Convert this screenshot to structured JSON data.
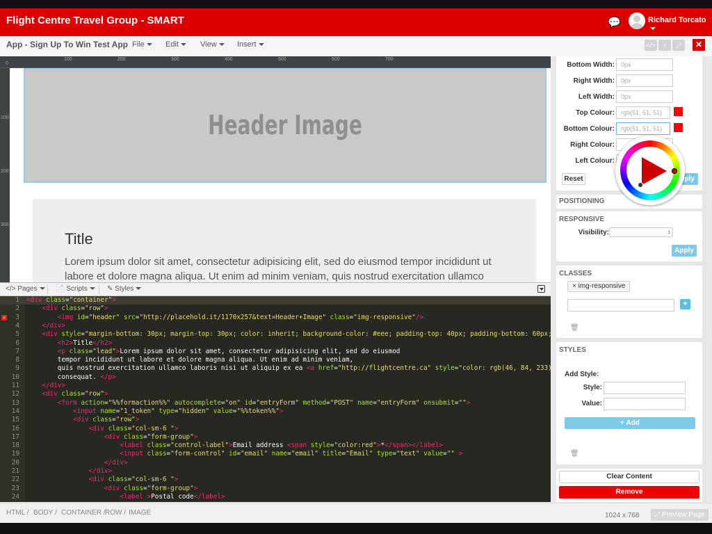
{
  "header": {
    "brand": "Flight Centre Travel Group - SMART",
    "user": "Richard Torcato",
    "brand_color": "#dd0000"
  },
  "menubar": {
    "app_title": "App - Sign Up To Win Test App",
    "menus": [
      "File",
      "Edit",
      "View",
      "Insert"
    ],
    "tools": [
      "code-icon",
      "info-icon",
      "expand-icon"
    ],
    "close": "✕"
  },
  "rulers": {
    "top": [
      "0",
      "100",
      "200",
      "300",
      "400",
      "500",
      "600",
      "700"
    ],
    "left": [
      "100",
      "200",
      "300"
    ]
  },
  "preview": {
    "header_image_text": "Header Image",
    "title": "Title",
    "lead": "Lorem ipsum dolor sit amet, consectetur adipisicing elit, sed do eiusmod tempor incididunt ut labore et dolore magna aliqua. Ut enim ad minim veniam, quis nostrud exercitation ullamco"
  },
  "editor_tabs": [
    "Pages",
    "Scripts",
    "Styles"
  ],
  "code_lines": [
    {
      "n": "1",
      "html": "<span class=\"t\">&lt;div</span> <span class=\"a\">class</span>=<span class=\"s\">\"container\"</span><span class=\"t\">&gt;</span>"
    },
    {
      "n": "2",
      "html": "    <span class=\"t\">&lt;div</span> <span class=\"a\">class</span>=<span class=\"s\">\"row\"</span><span class=\"t\">&gt;</span>"
    },
    {
      "n": "3",
      "html": "        <span class=\"t\">&lt;img</span> <span class=\"a\">id</span>=<span class=\"s\">\"header\"</span> <span class=\"a\">src</span>=<span class=\"s\">\"http://placehold.it/1170x257&amp;text=Header+Image\"</span> <span class=\"a\">class</span>=<span class=\"s\">\"img-responsive\"</span><span class=\"t\">/&gt;</span>"
    },
    {
      "n": "4",
      "html": "    <span class=\"t\">&lt;/div&gt;</span>"
    },
    {
      "n": "5",
      "html": "    <span class=\"t\">&lt;div</span> <span class=\"a\">style</span>=<span class=\"s\">\"margin-bottom: 30px; margin-top: 30px; color: inherit; background-color: #eee; padding-top: 40px; padding-bottom: 60px;</span>"
    },
    {
      "n": "6",
      "html": "        <span class=\"t\">&lt;h2&gt;</span>Title<span class=\"t\">&lt;/h2&gt;</span>"
    },
    {
      "n": "7",
      "html": "        <span class=\"t\">&lt;p</span> <span class=\"a\">class</span>=<span class=\"s\">\"lead\"</span><span class=\"t\">&gt;</span>Lorem ipsum dolor sit amet, consectetur adipisicing elit, sed do eiusmod"
    },
    {
      "n": "8",
      "html": "        tempor incididunt ut labore et dolore magna aliqua. Ut enim ad minim veniam,"
    },
    {
      "n": "9",
      "html": "        quis nostrud exercitation ullamco laboris nisi ut aliquip ex ea <span class=\"t\">&lt;a</span> <span class=\"a\">href</span>=<span class=\"s\">\"http://flightcentre.ca\"</span> <span class=\"a\">style</span>=<span class=\"s\">\"color: rgb(46, 84, 233);</span>"
    },
    {
      "n": "10",
      "html": "        consequat. <span class=\"t\">&lt;/p&gt;</span>"
    },
    {
      "n": "11",
      "html": "    <span class=\"t\">&lt;/div&gt;</span>"
    },
    {
      "n": "12",
      "html": "    <span class=\"t\">&lt;div</span> <span class=\"a\">class</span>=<span class=\"s\">\"row\"</span><span class=\"t\">&gt;</span>"
    },
    {
      "n": "13",
      "html": "        <span class=\"t\">&lt;form</span> <span class=\"a\">action</span>=<span class=\"s\">\"%%formaction%%\"</span> <span class=\"a\">autocomplete</span>=<span class=\"s\">\"on\"</span> <span class=\"a\">id</span>=<span class=\"s\">\"entryForm\"</span> <span class=\"a\">method</span>=<span class=\"s\">\"POST\"</span> <span class=\"a\">name</span>=<span class=\"s\">\"entryForm\"</span> <span class=\"a\">onsubmit</span>=<span class=\"s\">\"\"</span><span class=\"t\">&gt;</span>"
    },
    {
      "n": "14",
      "html": "            <span class=\"t\">&lt;input</span> <span class=\"a\">name</span>=<span class=\"s\">\"1_token\"</span> <span class=\"a\">type</span>=<span class=\"s\">\"hidden\"</span> <span class=\"a\">value</span>=<span class=\"s\">\"%%token%%\"</span><span class=\"t\">&gt;</span>"
    },
    {
      "n": "15",
      "html": "            <span class=\"t\">&lt;div</span> <span class=\"a\">class</span>=<span class=\"s\">\"row\"</span><span class=\"t\">&gt;</span>"
    },
    {
      "n": "16",
      "html": "                <span class=\"t\">&lt;div</span> <span class=\"a\">class</span>=<span class=\"s\">\"col-sm-6 \"</span><span class=\"t\">&gt;</span>"
    },
    {
      "n": "17",
      "html": "                    <span class=\"t\">&lt;div</span> <span class=\"a\">class</span>=<span class=\"s\">\"form-group\"</span><span class=\"t\">&gt;</span>"
    },
    {
      "n": "18",
      "html": "                        <span class=\"t\">&lt;label</span> <span class=\"a\">class</span>=<span class=\"s\">\"control-label\"</span><span class=\"t\">&gt;</span>Email address <span class=\"t\">&lt;span</span> <span class=\"a\">style</span>=<span class=\"s\">\"color:red\"</span><span class=\"t\">&gt;</span>*<span class=\"t\">&lt;/span&gt;&lt;/label&gt;</span>"
    },
    {
      "n": "19",
      "html": "                        <span class=\"t\">&lt;input</span> <span class=\"a\">class</span>=<span class=\"s\">\"form-control\"</span> <span class=\"a\">id</span>=<span class=\"s\">\"email\"</span> <span class=\"a\">name</span>=<span class=\"s\">\"email\"</span> <span class=\"a\">title</span>=<span class=\"s\">\"Email\"</span> <span class=\"a\">type</span>=<span class=\"s\">\"text\"</span> <span class=\"a\">value</span>=<span class=\"s\">\"\"</span> <span class=\"t\">&gt;</span>"
    },
    {
      "n": "20",
      "html": "                    <span class=\"t\">&lt;/div&gt;</span>"
    },
    {
      "n": "21",
      "html": "                <span class=\"t\">&lt;/div&gt;</span>"
    },
    {
      "n": "22",
      "html": "                <span class=\"t\">&lt;div</span> <span class=\"a\">class</span>=<span class=\"s\">\"col-sm-6 \"</span><span class=\"t\">&gt;</span>"
    },
    {
      "n": "23",
      "html": "                    <span class=\"t\">&lt;div</span> <span class=\"a\">class</span>=<span class=\"s\">\"form-group\"</span><span class=\"t\">&gt;</span>"
    },
    {
      "n": "24",
      "html": "                        <span class=\"t\">&lt;label</span> <span class=\"t\">&gt;</span>Postal code<span class=\"t\">&lt;/label&gt;</span>"
    }
  ],
  "border_panel": {
    "rows": [
      {
        "label": "Bottom Width:",
        "value": "0px"
      },
      {
        "label": "Right Width:",
        "value": "0px"
      },
      {
        "label": "Left Width:",
        "value": "0px"
      },
      {
        "label": "Top Colour:",
        "value": "rgb(51, 51, 51)"
      },
      {
        "label": "Bottom Colour:",
        "value": "rgb(51, 51, 51)"
      },
      {
        "label": "Right Colour:",
        "value": ""
      },
      {
        "label": "Left Colour:",
        "value": ""
      }
    ],
    "reset": "Reset",
    "apply": "Apply",
    "swatch_color": "#ff0000"
  },
  "positioning": {
    "title": "POSITIONING"
  },
  "responsive": {
    "title": "RESPONSIVE",
    "visibility_label": "Visibility:",
    "apply": "Apply"
  },
  "classes": {
    "title": "CLASSES",
    "tag": "img-responsive",
    "add": "+"
  },
  "styles": {
    "title": "STYLES",
    "add_style": "Add Style:",
    "style_label": "Style:",
    "value_label": "Value:",
    "add_button": "+ Add"
  },
  "actions": {
    "clear": "Clear Content",
    "remove": "Remove"
  },
  "status": {
    "breadcrumbs": [
      "HTML",
      "BODY",
      "CONTAINER",
      "ROW",
      "IMAGE"
    ],
    "dims": "1024 x 768",
    "preview": "Preview Page"
  }
}
